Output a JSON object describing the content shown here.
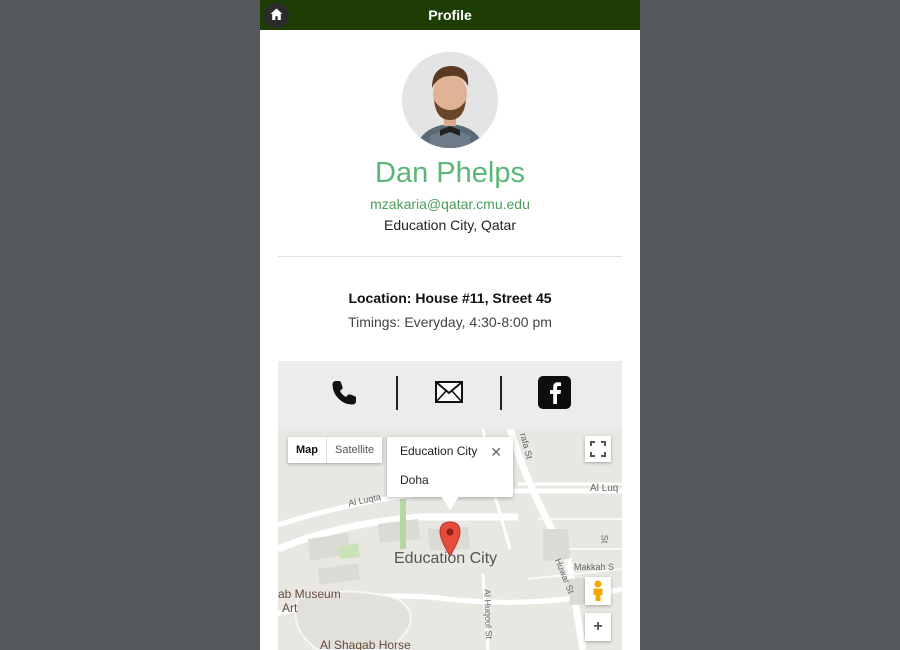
{
  "header": {
    "title": "Profile",
    "home_icon": "home-icon"
  },
  "profile": {
    "name": "Dan Phelps",
    "email": "mzakaria@qatar.cmu.edu",
    "city": "Education City, Qatar",
    "location": "Location: House #11, Street 45",
    "timings": "Timings: Everyday, 4:30-8:00 pm"
  },
  "contact": {
    "icons": [
      "phone-icon",
      "mail-icon",
      "facebook-icon"
    ]
  },
  "map": {
    "type_options": [
      "Map",
      "Satellite"
    ],
    "selected_type": "Map",
    "info_title": "Education City",
    "info_subtitle": "Doha",
    "info_close": "✕",
    "zoom_in": "+",
    "labels": {
      "main": "Education City",
      "museum_1": "ab Museum",
      "museum_2": "Art",
      "horse": "Al Shaqab Horse",
      "al_luqta_left": "Al Luqta",
      "al_luqta_right": "Al Luq",
      "makkah": "Makkah S",
      "huwar": "Huwar St",
      "huqoul": "Al Huqoul St",
      "rafa": "rafa St",
      "short_st": "St"
    }
  },
  "colors": {
    "header": "#1d3d04",
    "name": "#5bb777",
    "email": "#4a9d5c",
    "page_bg": "#54585b"
  }
}
